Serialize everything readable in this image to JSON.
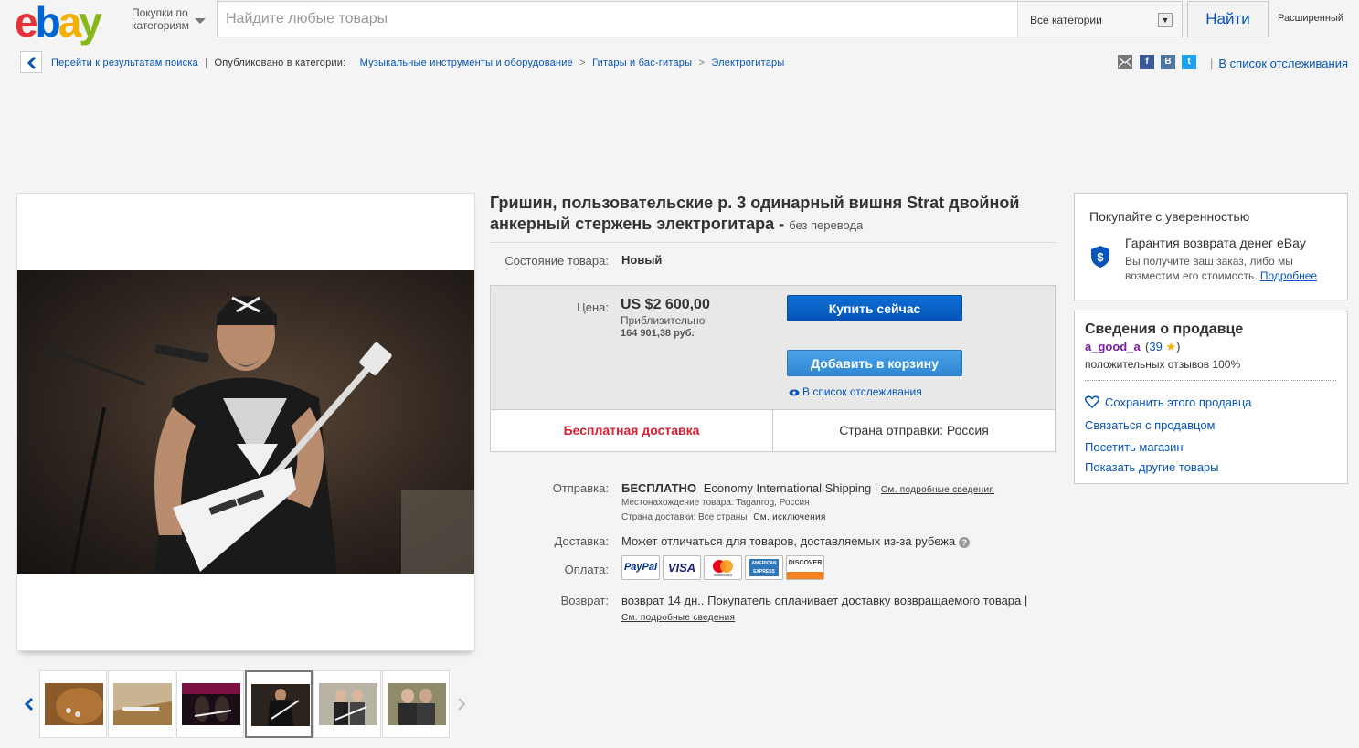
{
  "header": {
    "logo": {
      "e": "e",
      "b": "b",
      "a": "a",
      "y": "y"
    },
    "shop_by_category": "Покупки по категориям",
    "search_placeholder": "Найдите любые товары",
    "category_select": "Все категории",
    "search_button": "Найти",
    "advanced": "Расширенный"
  },
  "breadcrumb": {
    "back_results": "Перейти к результатам поиска",
    "published_in": "Опубликовано в категории:",
    "items": [
      "Музыкальные инструменты и оборудование",
      "Гитары и бас-гитары",
      "Электрогитары"
    ],
    "separator": ">",
    "pipe": "|"
  },
  "share": {
    "email_icon": "email-icon",
    "facebook": "f",
    "vk": "B",
    "twitter": "t",
    "watchlist": "В список отслеживания"
  },
  "listing": {
    "title": "Гришин, пользовательские р. 3 одинарный вишня Strat двойной анкерный стержень электрогитара -",
    "subtitle": "без перевода",
    "condition_label": "Состояние товара:",
    "condition_value": "Новый",
    "price_label": "Цена:",
    "price": "US $2 600,00",
    "approx_label": "Приблизительно",
    "approx_value": "164 901,38 руб.",
    "buy_now": "Купить сейчас",
    "add_to_cart": "Добавить в корзину",
    "watch": "В список отслеживания",
    "free_shipping": "Бесплатная доставка",
    "ship_from": "Страна отправки: Россия"
  },
  "details": {
    "shipping_label": "Отправка:",
    "shipping_free": "БЕСПЛАТНО",
    "shipping_service": "Economy International Shipping |",
    "shipping_link": "См. подробные сведения",
    "location": "Местонахождение товара: Taganrog, Россия",
    "ships_to_prefix": "Страна доставки: Все страны",
    "ships_to_link": "См. исключения",
    "delivery_label": "Доставка:",
    "delivery_value": "Может отличаться для товаров, доставляемых из-за рубежа",
    "help": "?",
    "payment_label": "Оплата:",
    "payment_methods": [
      "PayPal",
      "VISA",
      "mastercard",
      "AMERICAN EXPRESS",
      "DISCOVER"
    ],
    "returns_label": "Возврат:",
    "returns_value": "возврат 14 дн.. Покупатель оплачивает доставку возвращаемого товара |",
    "returns_link": "См. подробные сведения"
  },
  "confidence": {
    "title": "Покупайте с уверенностью",
    "guarantee_title": "Гарантия возврата денег eBay",
    "guarantee_desc": "Вы получите ваш заказ, либо мы возместим его стоимость.",
    "more_link": "Подробнее"
  },
  "seller": {
    "title": "Сведения о продавце",
    "name": "a_good_a",
    "score_open": "(",
    "score": "39",
    "score_close": ")",
    "star": "★",
    "positive": "положительных отзывов 100%",
    "save": "Сохранить этого продавца",
    "contact": "Связаться с продавцом",
    "visit_store": "Посетить магазин",
    "other_items": "Показать другие товары"
  },
  "colors": {
    "link": "#0654ba",
    "free_shipping": "#dd1e31",
    "buy_now": "#0654ba",
    "add_to_cart": "#3088d4"
  }
}
